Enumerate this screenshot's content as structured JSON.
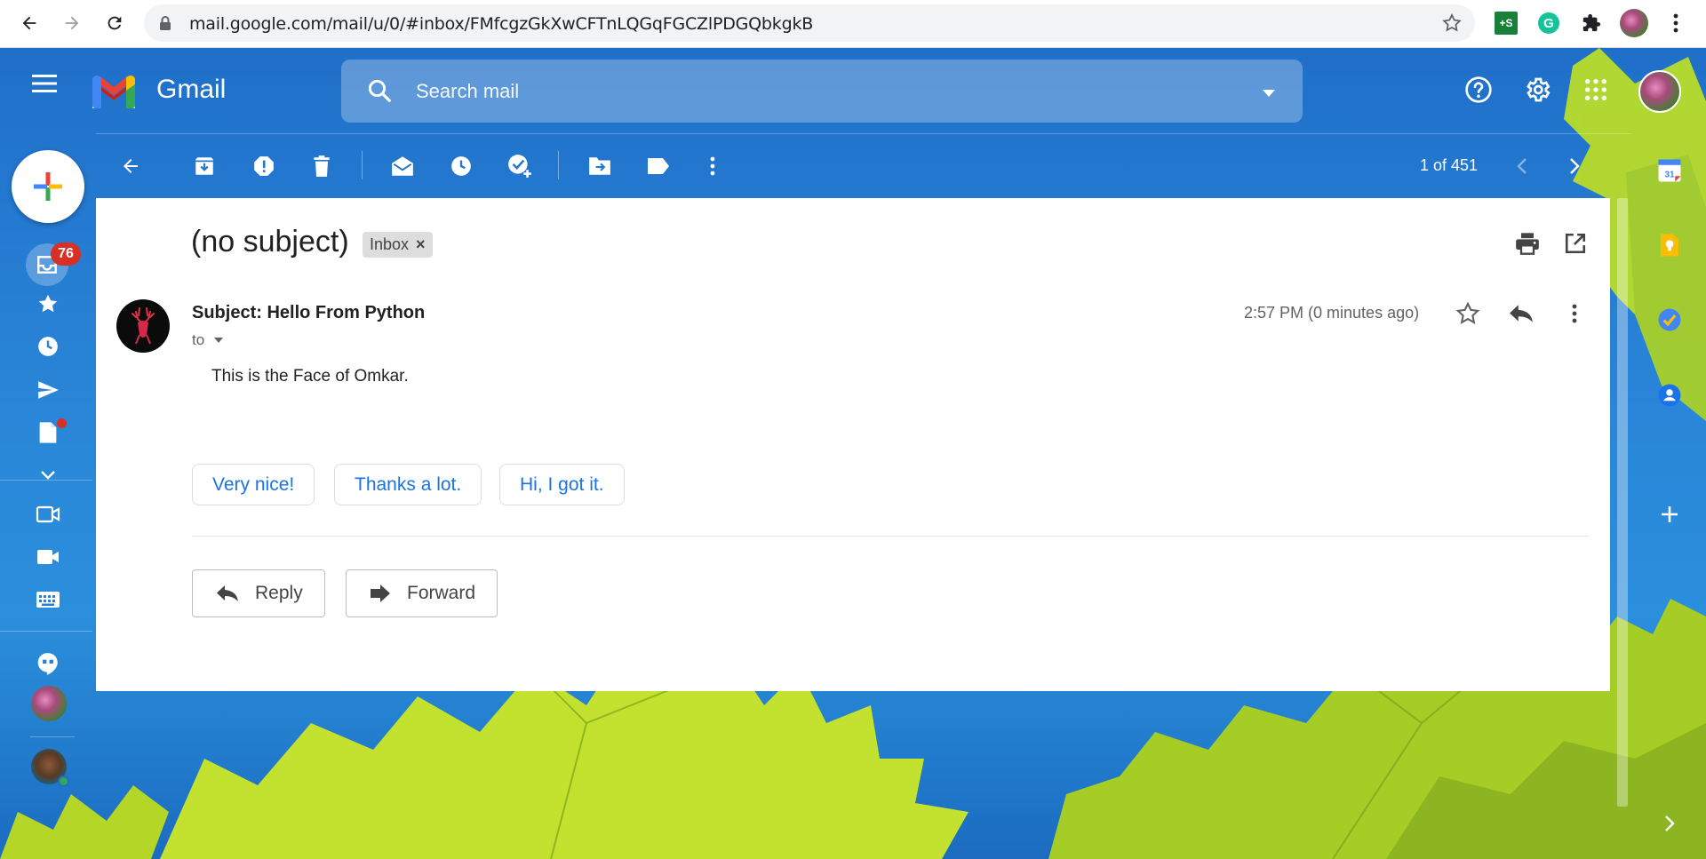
{
  "browser": {
    "url": "mail.google.com/mail/u/0/#inbox/FMfcgzGkXwCFTnLQGqFGCZlPDGQbkgkB"
  },
  "app": {
    "name": "Gmail",
    "search_placeholder": "Search mail"
  },
  "rail": {
    "inbox_badge": "76"
  },
  "toolbar": {
    "pager": "1 of 451"
  },
  "message": {
    "subject": "(no subject)",
    "label_chip": "Inbox",
    "sender_line": "Subject: Hello From Python",
    "to_label": "to",
    "timestamp": "2:57 PM (0 minutes ago)",
    "body": "This is the Face of Omkar.",
    "smart_replies": [
      "Very nice!",
      "Thanks a lot.",
      "Hi, I got it."
    ],
    "reply_label": "Reply",
    "forward_label": "Forward"
  },
  "colors": {
    "accent": "#1a73e8",
    "badge": "#d93025",
    "background_blue": "#2a86d8",
    "leaf_green": "#b5d92b"
  }
}
